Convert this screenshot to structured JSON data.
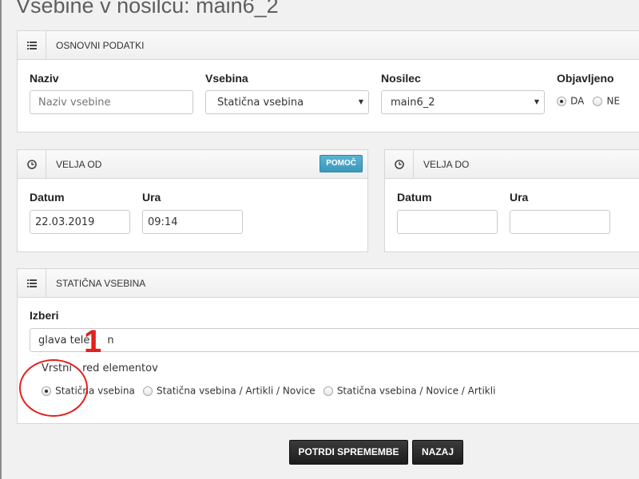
{
  "page": {
    "title": "Vsebine v nosilcu: main6_2"
  },
  "basic_panel": {
    "title": "OSNOVNI PODATKI",
    "icon": "list-icon",
    "name_label": "Naziv",
    "name_placeholder": "Naziv vsebine",
    "content_label": "Vsebina",
    "content_value": "Statična vsebina",
    "carrier_label": "Nosilec",
    "carrier_value": "main6_2",
    "published_label": "Objavljeno",
    "published_yes": "DA",
    "published_no": "NE",
    "published_selected": "DA"
  },
  "valid_from_panel": {
    "title": "VELJA OD",
    "icon": "clock-icon",
    "help_label": "POMOČ",
    "date_label": "Datum",
    "date_value": "22.03.2019",
    "time_label": "Ura",
    "time_value": "09:14"
  },
  "valid_to_panel": {
    "title": "VELJA DO",
    "icon": "clock-icon",
    "date_label": "Datum",
    "date_value": "",
    "time_label": "Ura",
    "time_value": ""
  },
  "static_panel": {
    "title": "STATIČNA VSEBINA",
    "icon": "list-icon",
    "choose_label": "Izberi",
    "choose_value": "glava tele",
    "choose_value_tail": "n",
    "order_label_start": "Vrstni ",
    "order_label_end": "red elementov",
    "order_options": [
      "Statična vsebina",
      "Statična vsebina / Artikli / Novice",
      "Statična vsebina / Novice / Artikli"
    ],
    "order_selected_index": 0
  },
  "actions": {
    "confirm_label": "POTRDI SPREMEMBE",
    "back_label": "NAZAJ"
  },
  "annotation": {
    "number": "1",
    "color": "#e3201d"
  }
}
